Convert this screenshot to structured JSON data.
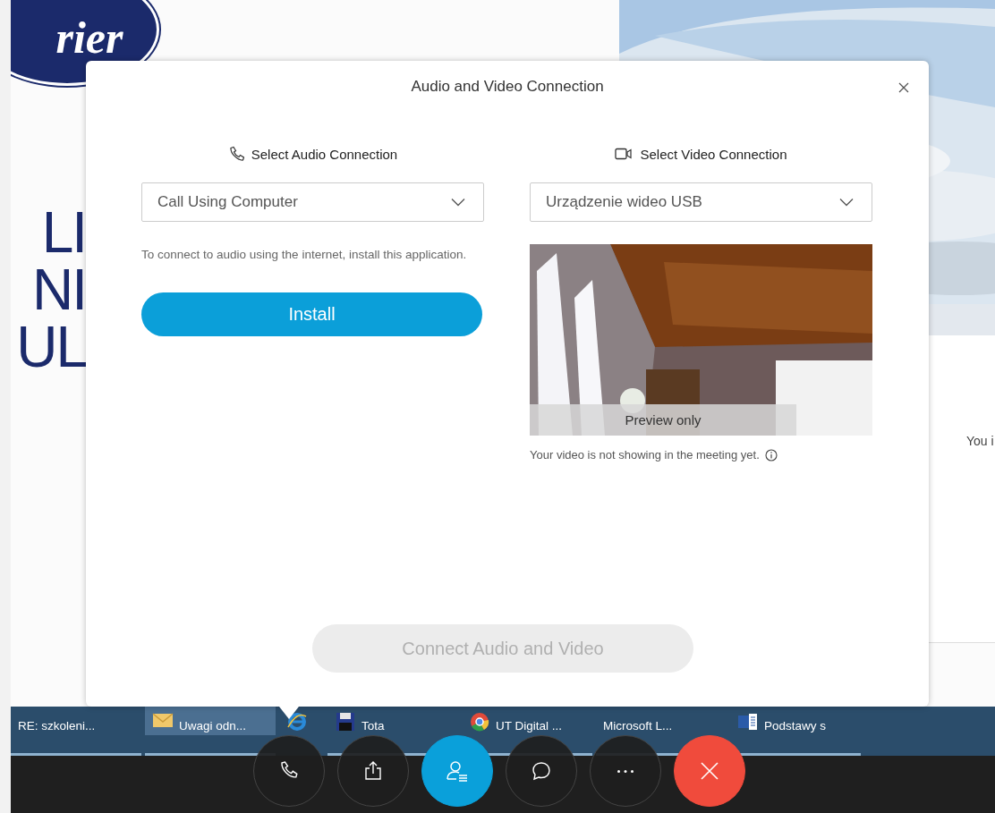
{
  "background": {
    "logo_text": "rier",
    "heading_lines": [
      "LI",
      "NI",
      "UL"
    ],
    "side_text": "You i"
  },
  "dialog": {
    "title": "Audio and Video Connection",
    "audio": {
      "heading": "Select Audio Connection",
      "select_value": "Call Using Computer",
      "description": "To connect to audio using the internet, install this application.",
      "button": "Install"
    },
    "video": {
      "heading": "Select Video Connection",
      "select_value": "Urządzenie wideo USB",
      "overlay": "Preview only",
      "note": "Your video is not showing in the meeting yet."
    },
    "connect_button": {
      "label": "Connect Audio and Video",
      "disabled": true
    }
  },
  "taskbar": [
    {
      "label": "RE: szkoleni...",
      "selected": false
    },
    {
      "kind": "mail",
      "label": "Uwagi odn...",
      "selected": true
    },
    {
      "kind": "ie",
      "selected": false
    },
    {
      "kind": "disk",
      "label": "Tota",
      "selected": false
    },
    {
      "kind": "chrome",
      "label": "UT Digital ...",
      "selected": false
    },
    {
      "label": "Microsoft L...",
      "selected": false
    },
    {
      "kind": "word",
      "label": "Podstawy s",
      "selected": false
    }
  ],
  "call_controls": [
    {
      "kind": "phone",
      "selected": false
    },
    {
      "kind": "share",
      "selected": false
    },
    {
      "kind": "participants",
      "selected": true
    },
    {
      "kind": "chat",
      "selected": false
    },
    {
      "kind": "more",
      "selected": false
    },
    {
      "kind": "end",
      "selected": false
    }
  ]
}
